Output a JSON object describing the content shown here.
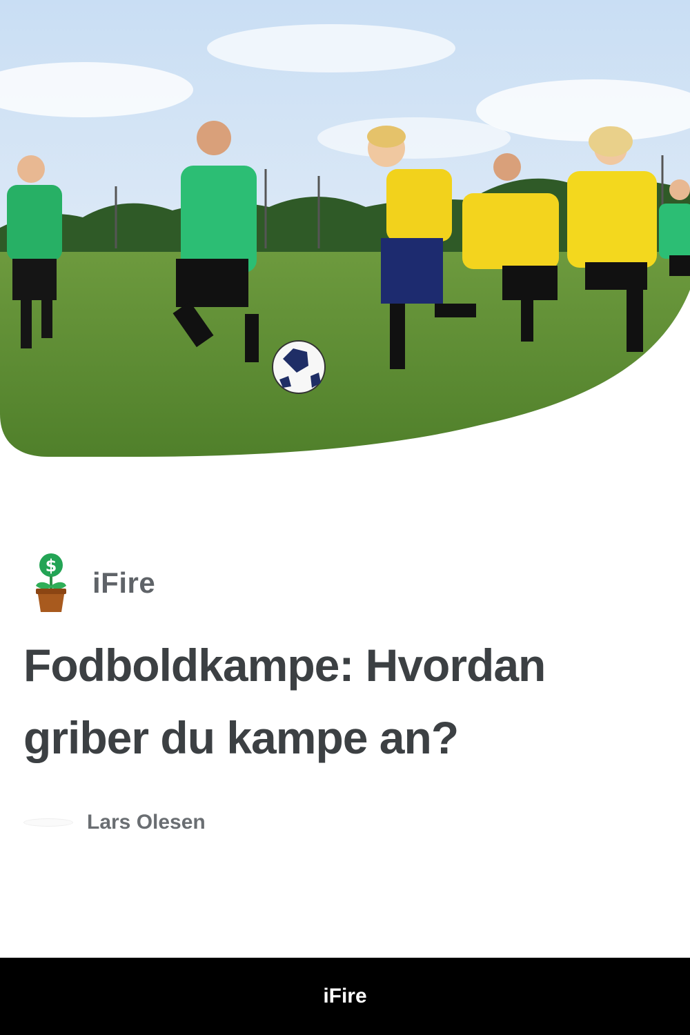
{
  "hero": {
    "image_description_icon": "photo-kids-soccer"
  },
  "publisher": {
    "name": "iFire",
    "logo_icon": "money-plant-icon"
  },
  "article": {
    "title": "Fodboldkampe: Hvordan griber du kampe an?",
    "author": "Lars Olesen"
  },
  "footer": {
    "label": "iFire"
  },
  "colors": {
    "title": "#3c4043",
    "publisher": "#5f6368",
    "footer_bg": "#000000",
    "footer_text": "#ffffff"
  }
}
